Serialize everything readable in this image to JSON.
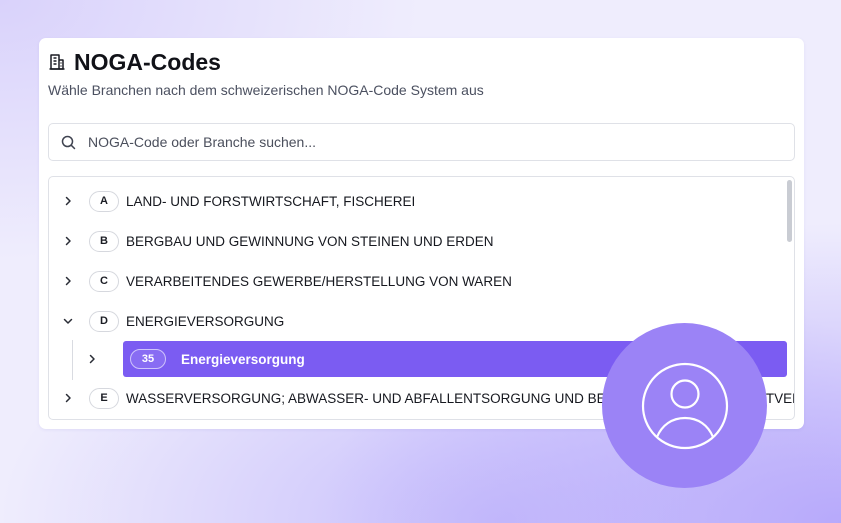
{
  "header": {
    "icon": "building-icon",
    "title": "NOGA-Codes",
    "subtitle": "Wähle Branchen nach dem schweizerischen NOGA-Code System aus"
  },
  "search": {
    "icon": "search-icon",
    "placeholder": "NOGA-Code oder Branche suchen...",
    "value": ""
  },
  "tree": {
    "items": [
      {
        "code": "A",
        "label": "LAND- UND FORSTWIRTSCHAFT, FISCHEREI",
        "expanded": false
      },
      {
        "code": "B",
        "label": "BERGBAU UND GEWINNUNG VON STEINEN UND ERDEN",
        "expanded": false
      },
      {
        "code": "C",
        "label": "VERARBEITENDES GEWERBE/HERSTELLUNG VON WAREN",
        "expanded": false
      },
      {
        "code": "D",
        "label": "ENERGIEVERSORGUNG",
        "expanded": true
      },
      {
        "code": "E",
        "label": "WASSERVERSORGUNG; ABWASSER- UND ABFALLENTSORGUNG UND BESEITIGUNG VON UMWELTVER",
        "expanded": false
      }
    ],
    "selected_child": {
      "code": "35",
      "label": "Energieversorgung",
      "parent": "D"
    }
  },
  "colors": {
    "accent": "#7b5cf2",
    "avatar": "#9b83f6",
    "card_bg": "#ffffff",
    "text": "#16181f"
  },
  "overlay": {
    "icon": "user-avatar-icon"
  }
}
